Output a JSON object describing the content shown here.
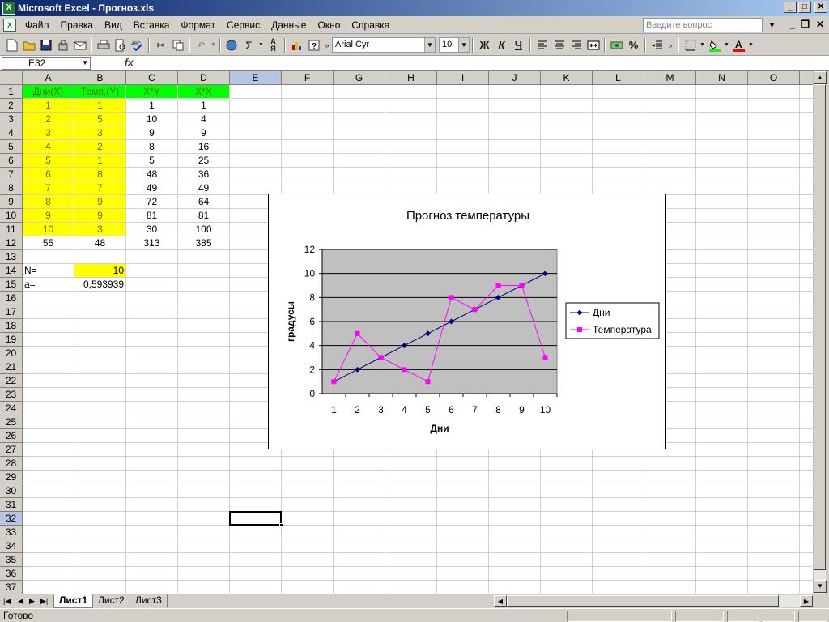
{
  "window": {
    "title": "Microsoft Excel - Прогноз.xls",
    "min": "_",
    "max": "□",
    "close": "✕"
  },
  "menu": {
    "items": [
      "Файл",
      "Правка",
      "Вид",
      "Вставка",
      "Формат",
      "Сервис",
      "Данные",
      "Окно",
      "Справка"
    ],
    "ask_placeholder": "Введите вопрос",
    "doc_min": "_",
    "doc_restore": "❐",
    "doc_close": "✕"
  },
  "toolbar": {
    "font_name": "Arial Cyr",
    "font_size": "10",
    "autosum": "Σ",
    "bold": "Ж",
    "italic": "К",
    "underline": "Ч",
    "percent": "%"
  },
  "formula_bar": {
    "name_box": "E32",
    "fx": "fx",
    "content": ""
  },
  "sheet": {
    "columns": [
      "A",
      "B",
      "C",
      "D",
      "E",
      "F",
      "G",
      "H",
      "I",
      "J",
      "K",
      "L",
      "M",
      "N",
      "O"
    ],
    "rows": [
      "1",
      "2",
      "3",
      "4",
      "5",
      "6",
      "7",
      "8",
      "9",
      "10",
      "11",
      "12",
      "13",
      "14",
      "15",
      "16",
      "17",
      "18",
      "19",
      "20",
      "21",
      "22",
      "23",
      "24",
      "25",
      "26",
      "27",
      "28",
      "29",
      "30",
      "31",
      "32",
      "33",
      "34",
      "35",
      "36",
      "37"
    ],
    "headers": [
      "Дни(X)",
      "Темп.(Y)",
      "X*Y",
      "X*X"
    ],
    "data": [
      [
        "1",
        "1",
        "1",
        "1"
      ],
      [
        "2",
        "5",
        "10",
        "4"
      ],
      [
        "3",
        "3",
        "9",
        "9"
      ],
      [
        "4",
        "2",
        "8",
        "16"
      ],
      [
        "5",
        "1",
        "5",
        "25"
      ],
      [
        "6",
        "8",
        "48",
        "36"
      ],
      [
        "7",
        "7",
        "49",
        "49"
      ],
      [
        "8",
        "9",
        "72",
        "64"
      ],
      [
        "9",
        "9",
        "81",
        "81"
      ],
      [
        "10",
        "3",
        "30",
        "100"
      ]
    ],
    "totals": [
      "55",
      "48",
      "313",
      "385"
    ],
    "n_label": "N=",
    "n_value": "10",
    "a_label": "a=",
    "a_value": "0,593939",
    "selected_cell": "E32"
  },
  "chart_data": {
    "type": "line",
    "title": "Прогноз температуры",
    "xlabel": "Дни",
    "ylabel": "градусы",
    "categories": [
      "1",
      "2",
      "3",
      "4",
      "5",
      "6",
      "7",
      "8",
      "9",
      "10"
    ],
    "ylim": [
      0,
      12
    ],
    "yticks": [
      "0",
      "2",
      "4",
      "6",
      "8",
      "10",
      "12"
    ],
    "grid": true,
    "legend": "right",
    "plot_bg": "#c0c0c0",
    "series": [
      {
        "name": "Дни",
        "values": [
          1,
          2,
          3,
          4,
          5,
          6,
          7,
          8,
          9,
          10
        ],
        "color": "#000080",
        "marker": "diamond"
      },
      {
        "name": "Температура",
        "values": [
          1,
          5,
          3,
          2,
          1,
          8,
          7,
          9,
          9,
          3
        ],
        "color": "#ff00ff",
        "marker": "square"
      }
    ]
  },
  "tabs": {
    "items": [
      "Лист1",
      "Лист2",
      "Лист3"
    ],
    "active": 0
  },
  "status": {
    "text": "Готово"
  }
}
